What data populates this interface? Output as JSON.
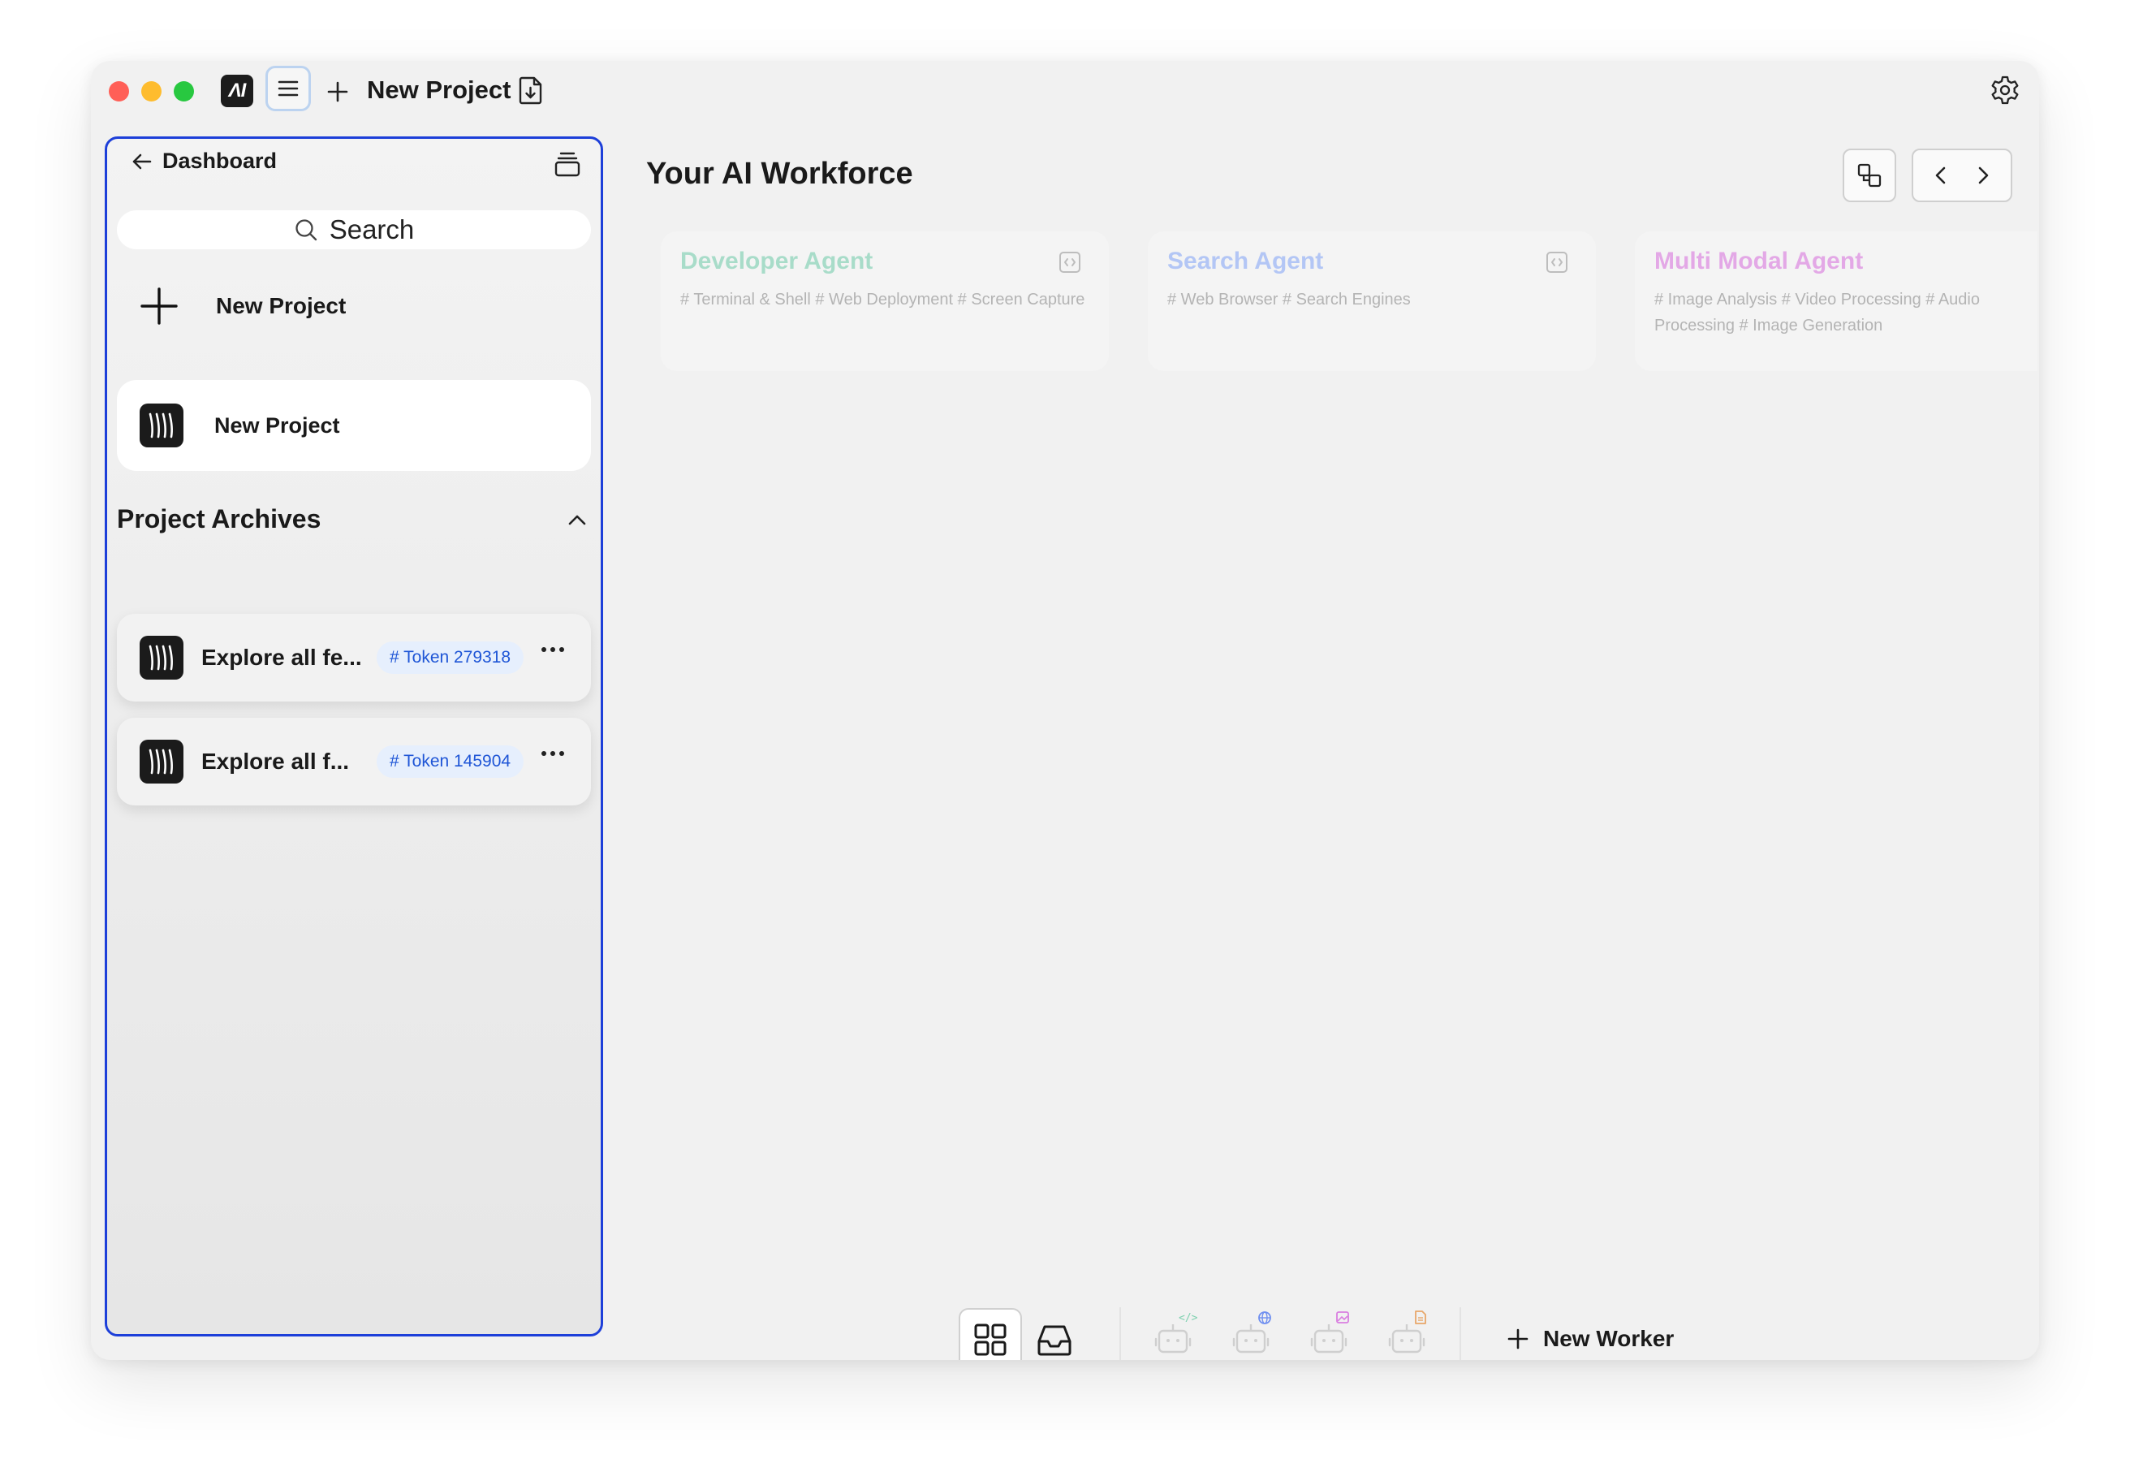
{
  "window": {
    "title": "New Project"
  },
  "sidebar": {
    "back_label": "Dashboard",
    "search_placeholder": "Search",
    "new_project_label": "New Project",
    "current_project": "New Project",
    "archives_title": "Project Archives",
    "archives": [
      {
        "name": "Explore all fe...",
        "token": "# Token 279318"
      },
      {
        "name": "Explore all f...",
        "token": "# Token 145904"
      }
    ]
  },
  "main": {
    "title": "Your AI Workforce",
    "agents": [
      {
        "name": "Developer Agent",
        "tags": "# Terminal & Shell # Web Deployment # Screen Capture",
        "color": "#a8dcc9"
      },
      {
        "name": "Search Agent",
        "tags": "# Web Browser # Search Engines",
        "color": "#b3c6f5"
      },
      {
        "name": "Multi Modal Agent",
        "tags": "# Image Analysis # Video Processing # Audio Processing # Image Generation",
        "color": "#e3a8e6"
      }
    ]
  },
  "dock": {
    "new_worker_label": "New Worker",
    "workers": [
      {
        "icon": "bot-code-icon",
        "accent": "#7fd1b0"
      },
      {
        "icon": "bot-globe-icon",
        "accent": "#6f8ff0"
      },
      {
        "icon": "bot-image-icon",
        "accent": "#d97fe0"
      },
      {
        "icon": "bot-document-icon",
        "accent": "#e8a76a"
      }
    ]
  }
}
